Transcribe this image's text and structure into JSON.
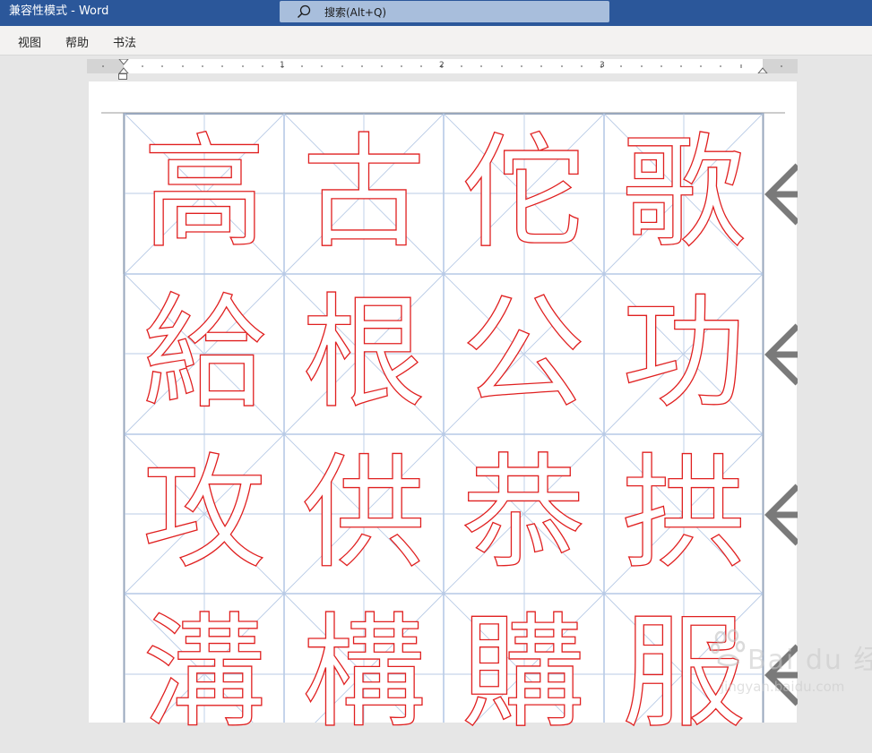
{
  "titlebar": {
    "title": "兼容性模式  -  Word",
    "search_label": "搜索(Alt+Q)",
    "bg_color": "#2b579a"
  },
  "ribbon": {
    "tabs": [
      "视图",
      "帮助",
      "书法"
    ]
  },
  "ruler": {
    "numbers": [
      "1",
      "2",
      "3"
    ]
  },
  "document": {
    "grid_rows": [
      [
        "高",
        "古",
        "佗",
        "歌"
      ],
      [
        "給",
        "根",
        "公",
        "功"
      ],
      [
        "攻",
        "供",
        "恭",
        "拱"
      ],
      [
        "溝",
        "構",
        "購",
        "服"
      ]
    ],
    "char_color": "#e02020",
    "grid_line_color": "#a6bde0",
    "row_marker_icon": "left-arrow-icon"
  },
  "watermark": {
    "text": "Bai du 经验",
    "url": "jingyan.baidu.com"
  }
}
